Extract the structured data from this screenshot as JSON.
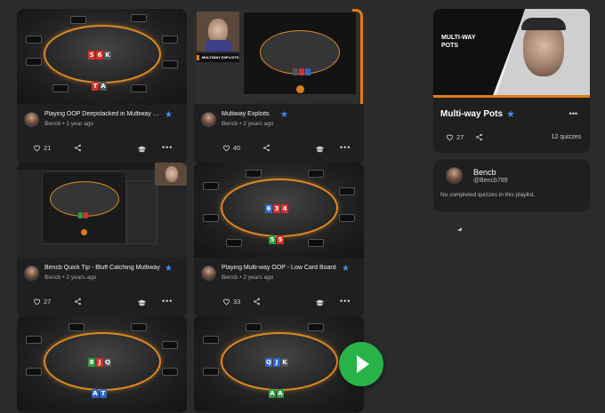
{
  "videos": [
    {
      "title": "Playing OOP Deepstacked in Multiway Pots",
      "author": "Bencb",
      "age": "1 year ago",
      "likes": "21",
      "cards_top": [
        "5",
        "6",
        "K"
      ],
      "cards_bottom": [
        "T",
        "A"
      ]
    },
    {
      "title": "Multiway Exploits",
      "author": "Bencb",
      "age": "2 years ago",
      "likes": "40",
      "overlay_label": "MULTIWAY EXPLOITS"
    },
    {
      "title": "Bencb Quick Tip - Bluff Catching Multiway",
      "author": "Bencb",
      "age": "2 years ago",
      "likes": "27"
    },
    {
      "title": "Playing Multi-way OOP - Low Card Board",
      "author": "Bencb",
      "age": "2 years ago",
      "likes": "33",
      "cards_top": [
        "6",
        "3",
        "4"
      ],
      "cards_bottom": [
        "5",
        "5"
      ]
    },
    {
      "title": "",
      "author": "",
      "age": "",
      "likes": "",
      "cards_top": [
        "8",
        "J",
        "Q"
      ],
      "cards_bottom": [
        "A",
        "T"
      ]
    },
    {
      "title": "",
      "author": "",
      "age": "",
      "likes": "",
      "cards_top": [
        "Q",
        "J",
        "K"
      ],
      "cards_bottom": [
        "A",
        "A"
      ]
    }
  ],
  "playlist": {
    "thumb_text_line1": "MULTI-WAY",
    "thumb_text_line2": "POTS",
    "title": "Multi-way Pots",
    "likes": "27",
    "quiz_count": "12 quizzes"
  },
  "user": {
    "name": "Bencb",
    "handle": "@Bencb789",
    "message": "No completed quizzes in this playlist."
  },
  "icons": {
    "star": "star-icon",
    "heart": "heart-icon",
    "share": "share-icon",
    "quiz": "graduation-cap-icon",
    "more": "more-icon",
    "play": "play-icon"
  },
  "colors": {
    "background": "#2b2b2b",
    "card": "#1f1f1f",
    "accent_orange": "#e07b19",
    "star_blue": "#3d8fe8",
    "play_green": "#27b347"
  }
}
